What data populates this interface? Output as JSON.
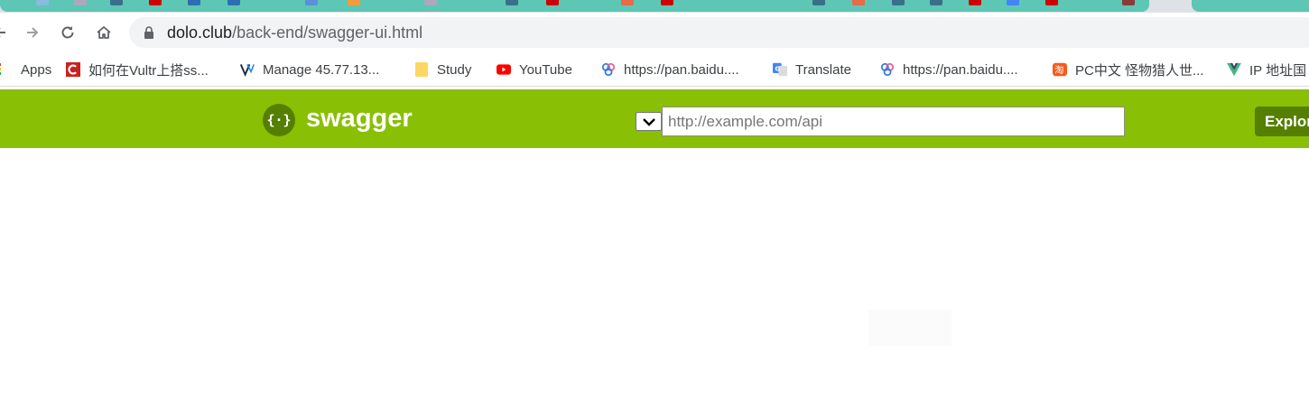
{
  "browser": {
    "url_host": "dolo.club",
    "url_path": "/back-end/swagger-ui.html"
  },
  "bookmarks": [
    {
      "label": "Apps",
      "icon": "apps-icon"
    },
    {
      "label": "如何在Vultr上搭ss...",
      "icon": "c-icon"
    },
    {
      "label": "Manage 45.77.13...",
      "icon": "vultr-icon"
    },
    {
      "label": "Study",
      "icon": "folder-icon"
    },
    {
      "label": "YouTube",
      "icon": "youtube-icon"
    },
    {
      "label": "https://pan.baidu....",
      "icon": "baidu-pan-icon"
    },
    {
      "label": "Translate",
      "icon": "translate-icon"
    },
    {
      "label": "https://pan.baidu....",
      "icon": "baidu-pan-icon"
    },
    {
      "label": "PC中文 怪物猎人世...",
      "icon": "taobao-icon"
    },
    {
      "label": "IP 地址国",
      "icon": "vue-icon"
    }
  ],
  "swagger": {
    "brand": "swagger",
    "url_placeholder": "http://example.com/api",
    "explore_label": "Explore",
    "header_color": "#89bf04"
  }
}
